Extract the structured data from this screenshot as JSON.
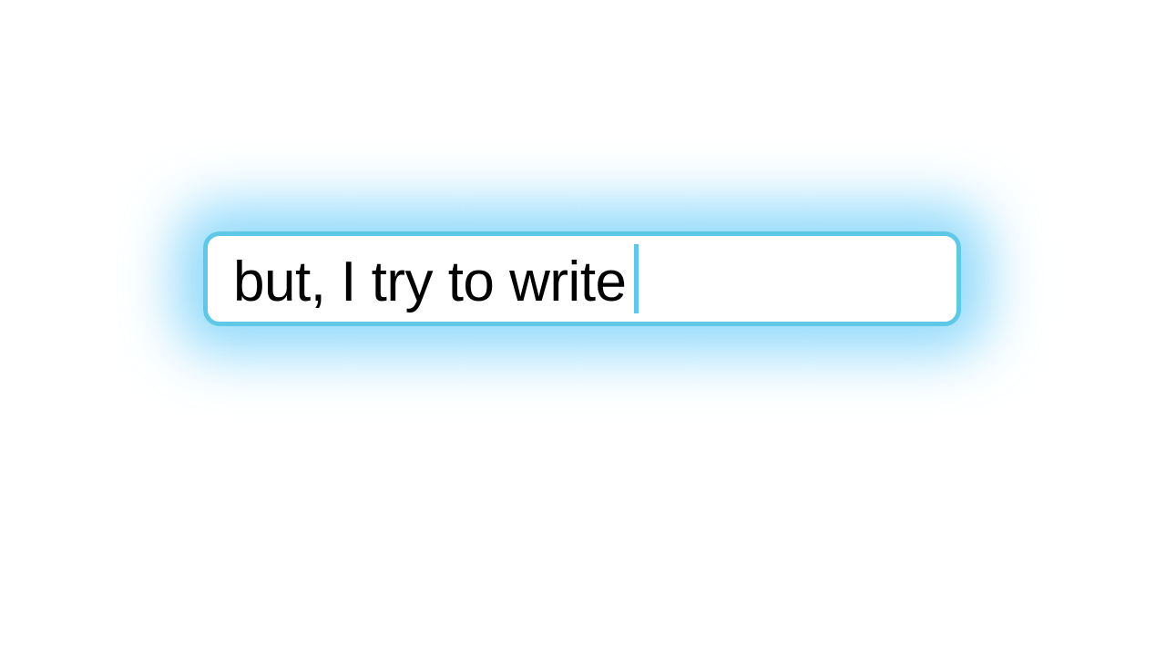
{
  "text_field": {
    "value": "but, I try to write",
    "accent_color": "#5ec8e6",
    "glow_color": "#6ecdfa"
  }
}
